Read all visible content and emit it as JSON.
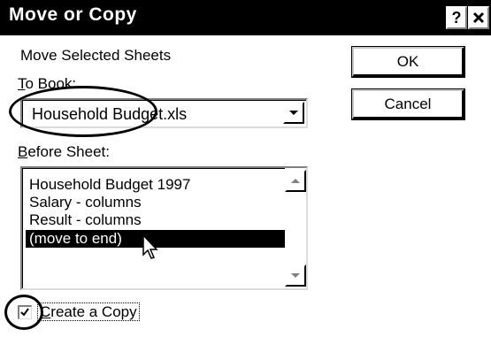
{
  "window": {
    "title": "Move or Copy",
    "help_label": "?",
    "close_label": "×"
  },
  "move_selected_label": "Move Selected Sheets",
  "to_book": {
    "label_mnemonic": "T",
    "label_rest": "o Book:",
    "value": "Household Budget.xls"
  },
  "before_sheet": {
    "label_mnemonic": "B",
    "label_rest": "efore Sheet:",
    "items": [
      {
        "label": "Household Budget 1997"
      },
      {
        "label": "Salary - columns"
      },
      {
        "label": "Result - columns"
      },
      {
        "label": "(move to end)"
      }
    ],
    "selected_index": 3
  },
  "buttons": {
    "ok": "OK",
    "cancel": "Cancel"
  },
  "create_copy": {
    "label_mnemonic": "C",
    "label_rest": "reate a Copy",
    "checked": true
  }
}
